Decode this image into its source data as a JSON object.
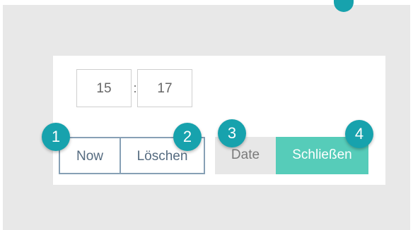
{
  "time_picker": {
    "hour_value": "15",
    "separator": ":",
    "minute_value": "17"
  },
  "buttons": {
    "now_label": "Now",
    "clear_label": "Löschen",
    "date_label": "Date",
    "close_label": "Schließen"
  },
  "badges": [
    "1",
    "2",
    "3",
    "4"
  ],
  "colors": {
    "background": "#e8e8e8",
    "panel": "#ffffff",
    "badge": "#17a2ad",
    "outline_border": "#87a0b5",
    "close_button": "#56ccb9",
    "date_button": "#e7e7e7"
  }
}
